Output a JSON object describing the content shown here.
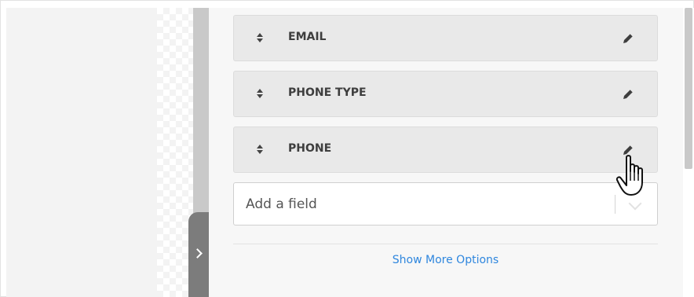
{
  "fields": [
    {
      "label": "EMAIL",
      "icon": "sort-icon",
      "action_icon": "pencil-icon"
    },
    {
      "label": "PHONE TYPE",
      "icon": "sort-icon",
      "action_icon": "pencil-icon"
    },
    {
      "label": "PHONE",
      "icon": "sort-icon",
      "action_icon": "pencil-icon"
    }
  ],
  "add_field": {
    "placeholder": "Add a field",
    "dropdown_icon": "chevron-down-icon"
  },
  "show_more": {
    "label": "Show More Options"
  },
  "collapse_icon": "chevron-right-icon",
  "cursor_icon": "hand-pointer-icon",
  "colors": {
    "link": "#2e86de",
    "row_background": "#e9e9e9",
    "label_text": "#3e3e3e",
    "handle": "#7c7c7c"
  }
}
